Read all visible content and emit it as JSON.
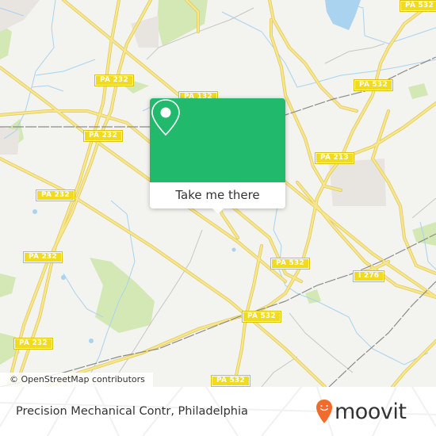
{
  "map": {
    "shields": [
      {
        "label": "PA 532",
        "pos": "top-right"
      },
      {
        "label": "PA 232",
        "pos": "top-left-upper"
      },
      {
        "label": "PA 132",
        "pos": "top-center"
      },
      {
        "label": "PA 532",
        "pos": "upper-right"
      },
      {
        "label": "PA 232",
        "pos": "left-mid-upper"
      },
      {
        "label": "PA 213",
        "pos": "right-mid-upper"
      },
      {
        "label": "PA 232",
        "pos": "left-mid"
      },
      {
        "label": "PA 232",
        "pos": "left-lower-mid"
      },
      {
        "label": "PA 532",
        "pos": "center-right"
      },
      {
        "label": "I 276",
        "pos": "right-mid"
      },
      {
        "label": "PA 532",
        "pos": "center-lower"
      },
      {
        "label": "PA 232",
        "pos": "left-lower"
      },
      {
        "label": "PA 532",
        "pos": "bottom-center"
      }
    ],
    "attribution": "© OpenStreetMap contributors",
    "colors": {
      "land": "#f3f3f0",
      "road": "#f5e27a",
      "water": "#a9d3ee",
      "park": "#d4e8b6",
      "rail": "#888888"
    }
  },
  "popup": {
    "icon": "map-pin-icon",
    "action_label": "Take me there",
    "color": "#21b96b"
  },
  "footer": {
    "place_name": "Precision Mechanical Contr, Philadelphia",
    "brand": "moovit",
    "brand_icon": "moovit-pin-smile-icon",
    "brand_color": "#f26b2a"
  }
}
